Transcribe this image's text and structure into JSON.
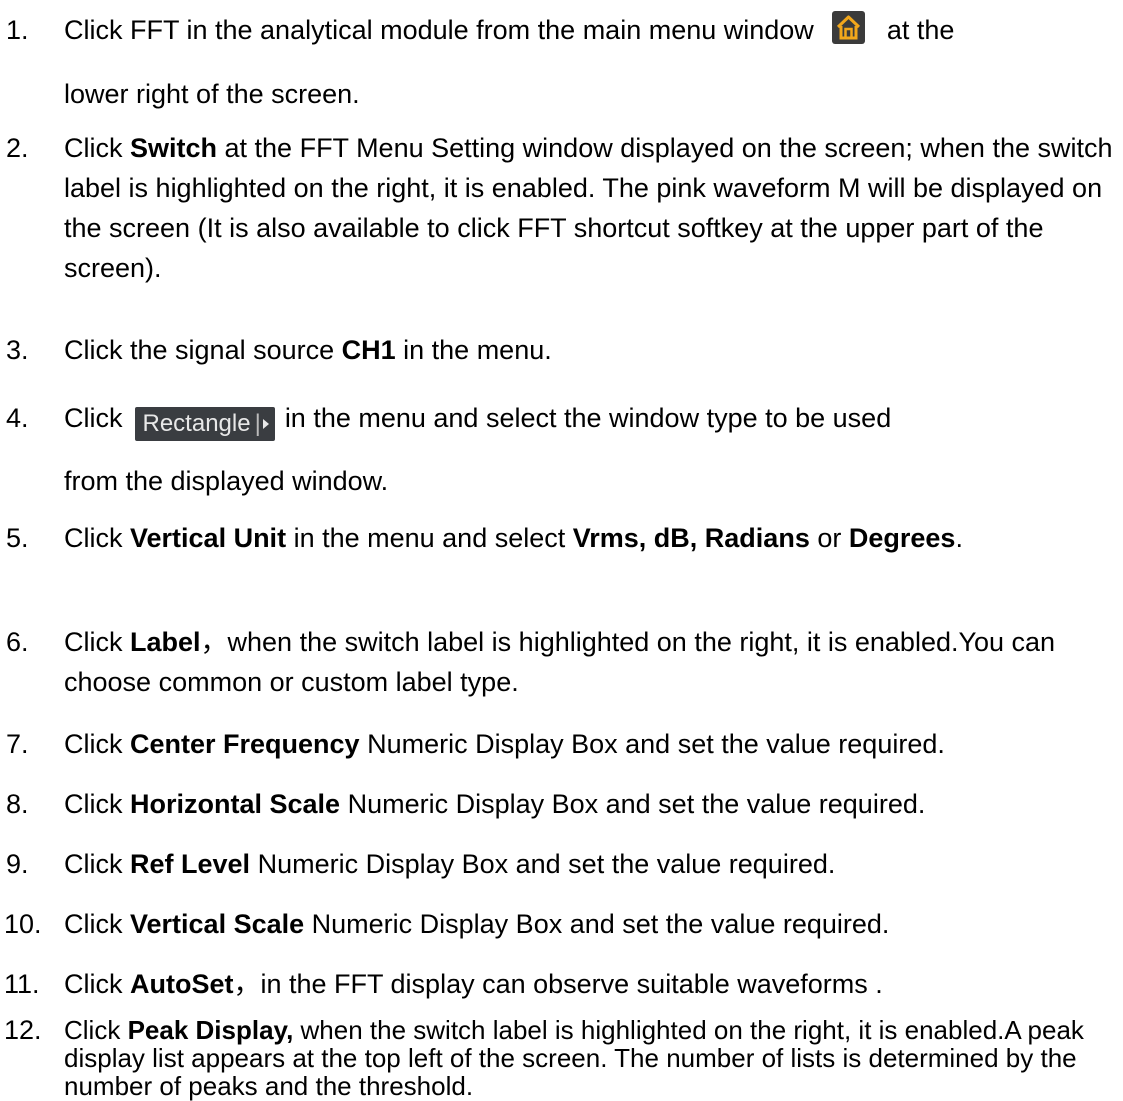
{
  "steps": [
    {
      "num": "1.",
      "pre": "Click FFT in the analytical module from the main menu window",
      "icon": "home-icon",
      "post1": "at the",
      "post2": "lower right of the screen."
    },
    {
      "num": "2.",
      "pre": "Click ",
      "bold": "Switch",
      "post": " at the FFT Menu Setting window displayed on the screen; when the switch label is highlighted on the right, it is enabled. The pink waveform M will be displayed on the screen (It is also available to click FFT shortcut softkey at the upper part of the screen)."
    },
    {
      "num": "3.",
      "pre": "Click the signal source ",
      "bold": "CH1",
      "post": " in the menu."
    },
    {
      "num": "4.",
      "pre": "Click",
      "button_label": "Rectangle",
      "post1": "in the menu and select the window type to be used",
      "post2": "from the displayed window."
    },
    {
      "num": "5.",
      "pre": "Click ",
      "bold": "Vertical Unit",
      "mid": " in the menu and select ",
      "bold2": "Vrms, dB, Radians",
      "mid2": " or ",
      "bold3": "Degrees",
      "post": "."
    },
    {
      "num": "6.",
      "pre": "Click ",
      "bold": "Label",
      "post": "，when the switch label is highlighted on the right, it is enabled.You can choose common or custom label type."
    },
    {
      "num": "7.",
      "pre": "Click ",
      "bold": "Center Frequency",
      "post": " Numeric Display Box and set the value required."
    },
    {
      "num": "8.",
      "pre": "Click ",
      "bold": "Horizontal Scale",
      "post": " Numeric Display Box and set the value required."
    },
    {
      "num": "9.",
      "pre": "Click ",
      "bold": "Ref Level",
      "post": " Numeric Display Box and set the value required."
    },
    {
      "num": "10.",
      "pre": "Click ",
      "bold": "Vertical Scale",
      "post": " Numeric Display Box and set the value required."
    },
    {
      "num": "11.",
      "pre": "Click ",
      "bold": "AutoSet",
      "post": "，in the FFT display can observe suitable waveforms ."
    },
    {
      "num": "12.",
      "pre": "Click ",
      "bold": "Peak Display,",
      "post": " when the switch label is highlighted on the right, it is enabled.A peak display list appears at the top left of the screen. The number of lists is determined by the number of peaks and the threshold."
    }
  ],
  "colors": {
    "icon_bg": "#3b3b3b",
    "icon_fg": "#f2a71b",
    "button_bg": "#3a3d41",
    "button_text": "#e8e8e8"
  }
}
